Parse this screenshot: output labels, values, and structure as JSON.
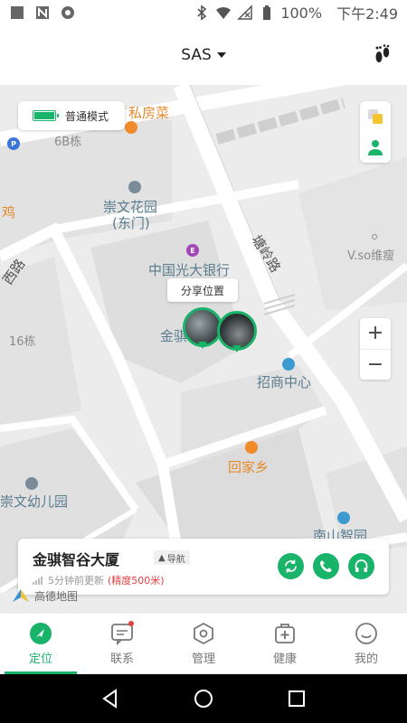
{
  "status_bar": {
    "battery": "100%",
    "time": "下午2:49"
  },
  "header": {
    "device_name": "SAS"
  },
  "map": {
    "mode_label": "普通模式",
    "share_label": "分享位置",
    "zoom_in": "+",
    "zoom_out": "−",
    "labels": {
      "private_kitchen": "私房菜",
      "building_6b": "6B栋",
      "chongwen_garden": "崇文花园",
      "east_gate": "(东门)",
      "chicken": "鸡",
      "xi_road": "西路",
      "everbright_bank": "中国光大银行",
      "jin_qi": "金骐",
      "tangling_road": "塘岭路",
      "vso": "V.so维瘦",
      "building_16": "16栋",
      "cmb_center": "招商中心",
      "huijia_xiang": "回家乡",
      "kindergarten": "崇文幼儿园",
      "nanshan_zhigu": "南山智园"
    },
    "provider": "高德地图"
  },
  "card": {
    "location_name": "金骐智谷大厦",
    "nav_label": "导航",
    "updated": "5分钟前更新",
    "accuracy": "(精度500米)"
  },
  "bottom_nav": [
    {
      "label": "定位",
      "icon": "location-icon",
      "active": true
    },
    {
      "label": "联系",
      "icon": "chat-icon",
      "active": false
    },
    {
      "label": "管理",
      "icon": "manage-icon",
      "active": false
    },
    {
      "label": "健康",
      "icon": "health-icon",
      "active": false
    },
    {
      "label": "我的",
      "icon": "profile-icon",
      "active": false
    }
  ],
  "colors": {
    "accent": "#1ab36a",
    "alert": "#e24040",
    "map_bg": "#ececec"
  }
}
